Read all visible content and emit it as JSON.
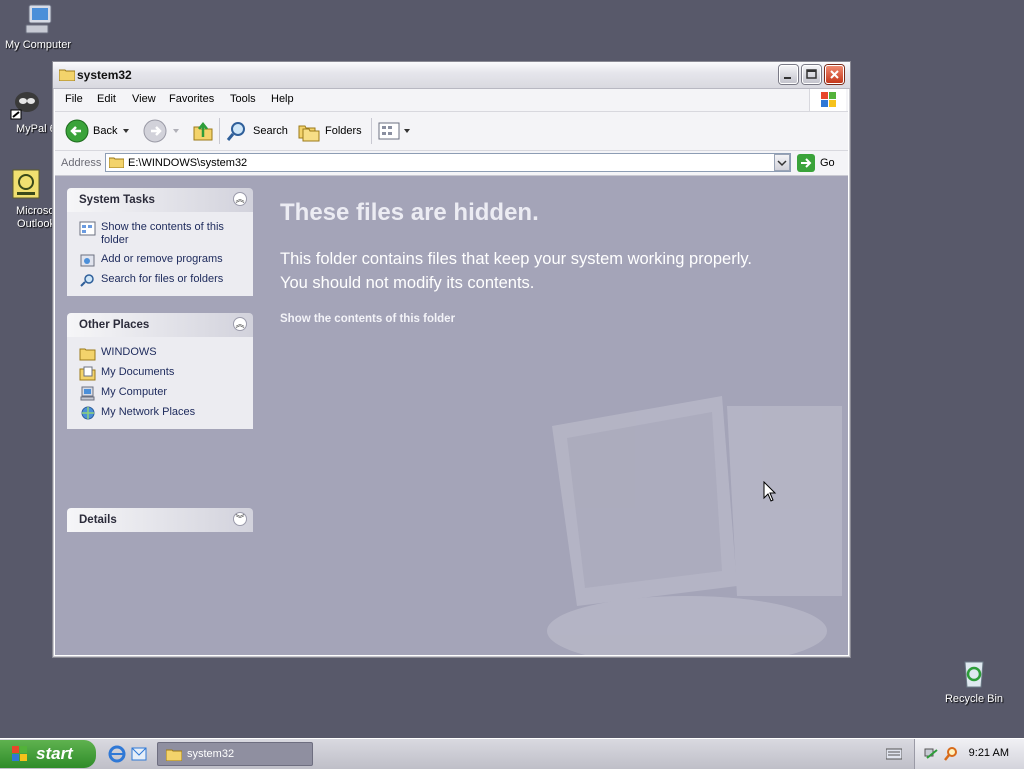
{
  "desktop": {
    "icons": [
      {
        "label": "My Computer"
      },
      {
        "label": "MyPal 6"
      },
      {
        "label": "Microsoft Outlook"
      },
      {
        "label": "Recycle Bin"
      }
    ]
  },
  "window": {
    "title": "system32",
    "menu": [
      "File",
      "Edit",
      "View",
      "Favorites",
      "Tools",
      "Help"
    ],
    "toolbar": {
      "back_label": "Back",
      "search_label": "Search",
      "folders_label": "Folders"
    },
    "address": {
      "label": "Address",
      "value": "E:\\WINDOWS\\system32",
      "go_label": "Go"
    },
    "left_pane": {
      "system_tasks": {
        "title": "System Tasks",
        "items": [
          {
            "label": "Show the contents of this folder"
          },
          {
            "label": "Add or remove programs"
          },
          {
            "label": "Search for files or folders"
          }
        ]
      },
      "other_places": {
        "title": "Other Places",
        "items": [
          {
            "label": "WINDOWS"
          },
          {
            "label": "My Documents"
          },
          {
            "label": "My Computer"
          },
          {
            "label": "My Network Places"
          }
        ]
      },
      "details": {
        "title": "Details"
      }
    },
    "content": {
      "heading": "These files are hidden.",
      "message_line1": "This folder contains files that keep your system working properly.",
      "message_line2": "You should not modify its contents.",
      "show_link": "Show the contents of this folder"
    }
  },
  "taskbar": {
    "start_label": "start",
    "task_button": "system32",
    "clock": "9:21 AM"
  },
  "colors": {
    "desktop": "#58596a",
    "content_bg": "#a4a4b8",
    "start_green": "#3c9a34"
  }
}
